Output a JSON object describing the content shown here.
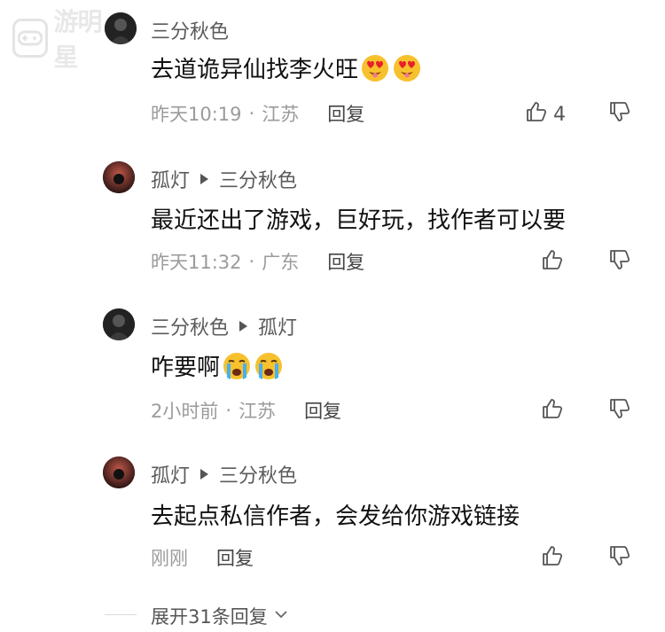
{
  "watermark": {
    "text": "游明星"
  },
  "comments": [
    {
      "author": "三分秋色",
      "reply_to": "",
      "content": "去道诡异仙找李火旺",
      "emojis": [
        "heart-eyes-emoji",
        "heart-eyes-emoji"
      ],
      "time": "昨天10:19",
      "location": "江苏",
      "reply_label": "回复",
      "like_count": "4"
    },
    {
      "author": "孤灯",
      "reply_to": "三分秋色",
      "content": "最近还出了游戏，巨好玩，找作者可以要",
      "emojis": [],
      "time": "昨天11:32",
      "location": "广东",
      "reply_label": "回复",
      "like_count": ""
    },
    {
      "author": "三分秋色",
      "reply_to": "孤灯",
      "content": "咋要啊",
      "emojis": [
        "crying-emoji",
        "crying-emoji"
      ],
      "time": "2小时前",
      "location": "江苏",
      "reply_label": "回复",
      "like_count": ""
    },
    {
      "author": "孤灯",
      "reply_to": "三分秋色",
      "content": "去起点私信作者，会发给你游戏链接",
      "emojis": [],
      "time": "刚刚",
      "location": "",
      "reply_label": "回复",
      "like_count": ""
    }
  ],
  "expand": {
    "label": "展开31条回复"
  },
  "colors": {
    "text_primary": "#111111",
    "text_secondary": "#5b5b5b",
    "text_meta": "#9b9b9b",
    "background": "#ffffff"
  }
}
